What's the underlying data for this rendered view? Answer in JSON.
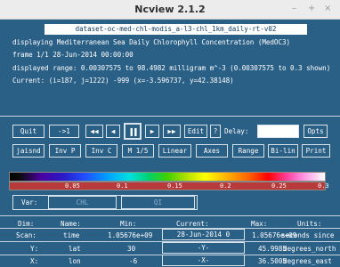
{
  "window": {
    "title": "Ncview 2.1.2",
    "controls": [
      "–",
      "+",
      "×"
    ]
  },
  "info": {
    "filename": "dataset-oc-med-chl-modis_a-l3-chl_1km_daily-rt-v02",
    "description": "displaying Mediterranean Sea Daily Chlorophyll Concentration (MedOC3)",
    "frame": "frame 1/1 28-Jun-2014 00:00:00",
    "range": "displayed range: 0.00307575 to 98.4982 milligram m^-3 (0.00307575 to 0.3 shown)",
    "current": "Current: (i=187, j=1222) -999 (x=-3.596737, y=42.38148)"
  },
  "toolbar1": {
    "quit": "Quit",
    "step": "->1",
    "rewind": "◀◀",
    "back": "◀",
    "pause": "▐▐",
    "forward": "▶",
    "fastforward": "▶▶",
    "edit": "Edit",
    "help": "?",
    "delay_label": "Delay:",
    "opts": "Opts"
  },
  "toolbar2": {
    "colormap": "jaisnd",
    "inv_p": "Inv P",
    "inv_c": "Inv C",
    "magnify": "M 1/5",
    "linear": "Linear",
    "axes": "Axes",
    "range": "Range",
    "bilin": "Bi-lin",
    "print": "Print"
  },
  "colorbar": {
    "labels": [
      "0.05",
      "0.1",
      "0.15",
      "0.2",
      "0.25",
      "0.3"
    ]
  },
  "variables": {
    "label": "Var:",
    "options": [
      "CHL",
      "QI"
    ],
    "selected": "CHL"
  },
  "dimensions": {
    "headers": [
      "Dim:",
      "Name:",
      "Min:",
      "Current:",
      "Max:",
      "Units:"
    ],
    "rows": [
      {
        "dim": "Scan:",
        "name": "time",
        "min": "1.05676e+09",
        "current": "28-Jun-2014 0",
        "max": "1.05676e+09",
        "units": "seconds since"
      },
      {
        "dim": "Y:",
        "name": "lat",
        "min": "30",
        "current": "-Y-",
        "max": "45.9985",
        "units": "degrees_north"
      },
      {
        "dim": "X:",
        "name": "lon",
        "min": "-6",
        "current": "-X-",
        "max": "36.5005",
        "units": "degrees_east"
      }
    ]
  },
  "colors": {
    "panel": "#2a5f86",
    "border": "#d8e3ec",
    "colorbar_label_bg": "#b83a3a"
  }
}
